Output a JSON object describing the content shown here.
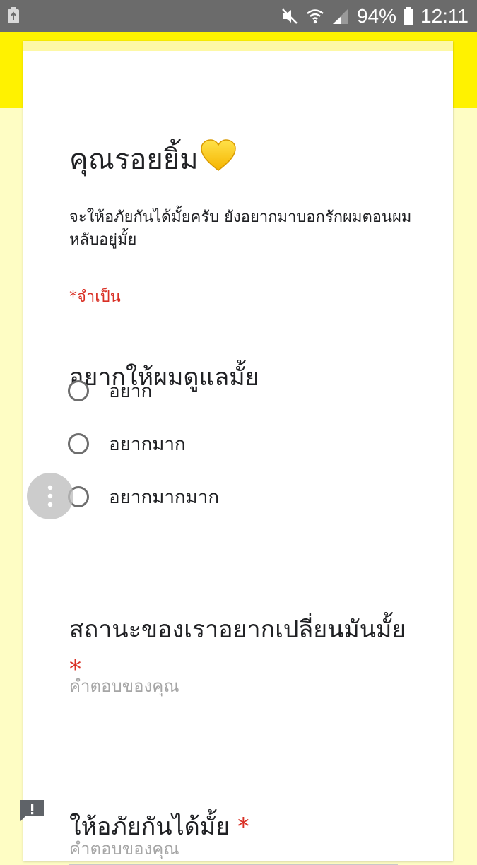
{
  "status_bar": {
    "battery_percent": "94%",
    "time": "12:11",
    "icons": [
      "recycle-icon",
      "mute-icon",
      "wifi-icon",
      "signal-icon",
      "battery-icon"
    ]
  },
  "form": {
    "title": "คุณรอยยิ้ม",
    "title_icon": "yellow-heart-icon",
    "description": "จะให้อภัยกันได้มั้ยครับ ยังอยากมาบอกรักผมตอนผมหลับอยู่มั้ย",
    "required_note": "*จำเป็น"
  },
  "questions": [
    {
      "title": "อยากให้ผมดูแลมั้ย",
      "options": [
        "อยาก",
        "อยากมาก",
        "อยากมากมาก"
      ]
    },
    {
      "title": "สถานะของเราอยากเปลี่ยนมันมั้ย",
      "required_mark": "*",
      "placeholder": "คำตอบของคุณ"
    },
    {
      "title": "ให้อภัยกันได้มั้ย",
      "required_mark": "*",
      "placeholder": "คำตอบของคุณ"
    }
  ],
  "colors": {
    "status_bar": "#6b6b6b",
    "accent_yellow": "#fff200",
    "page_background": "#fefdc4",
    "required_red": "#d93025"
  }
}
